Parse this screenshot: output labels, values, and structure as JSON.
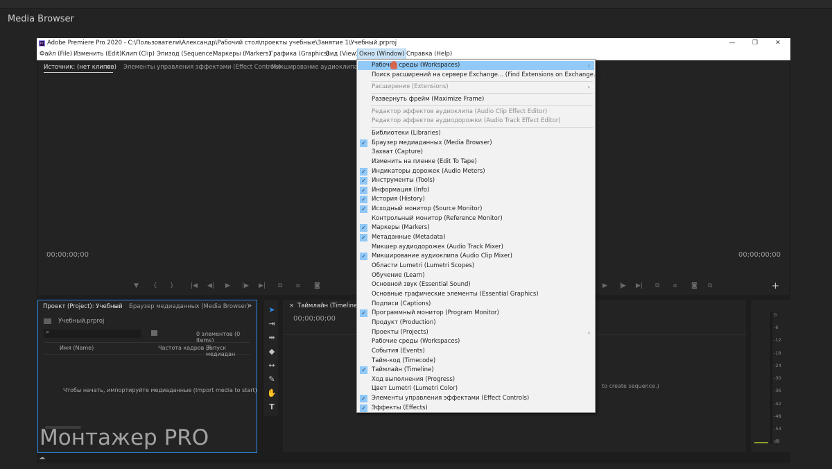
{
  "background": {
    "panel_title": "Media Browser"
  },
  "titlebar": {
    "logo": "Pr",
    "title": "Adobe Premiere Pro 2020 - C:\\Пользователи\\Александр\\Рабочий стол\\проекты учебные\\Занятие 1\\Учебный.prproj",
    "minimize": "—",
    "restore": "❐",
    "close": "✕"
  },
  "menubar": {
    "items": [
      "Файл (File)",
      "Изменить (Edit)",
      "Клип (Clip)",
      "Эпизод (Sequence)",
      "Маркеры (Markers)",
      "Графика (Graphics)",
      "Вид (View)",
      "Окно (Window)",
      "Справка (Help)"
    ]
  },
  "source_panel": {
    "tabs": [
      "Источник: (нет клипов)",
      "Элементы управления эффектами (Effect Controls)",
      "Микширование аудиоклипа (Aud"
    ],
    "timecode_left": "00;00;00;00",
    "timecode_right": "00;00;00;00"
  },
  "project_panel": {
    "tabs": [
      "Проект (Project): Учебный",
      "Браузер медиаданных (Media Browser)"
    ],
    "file_name": "Учебный.prproj",
    "item_count": "0 элементов (0 Items)",
    "columns": [
      "Имя (Name)",
      "Частота кадров (F",
      "Запуск медиадан"
    ],
    "empty_message": "Чтобы начать, импортируйте медиаданные (Import media to start)"
  },
  "timeline_panel": {
    "tab": "Таймлайн (Timeline): (",
    "timecode": "00;00;00;00",
    "hint_fragment": "to create sequence.)"
  },
  "meters": {
    "labels": [
      "0",
      "-6",
      "-12",
      "-18",
      "-24",
      "-30",
      "-36",
      "-42",
      "-48",
      "-54",
      "dB"
    ]
  },
  "window_menu": {
    "items": [
      {
        "label": "Рабочие среды (Workspaces)",
        "checked": false,
        "submenu": true,
        "highlight": true,
        "disabled": false
      },
      {
        "label": "Поиск расширений на сервере Exchange... (Find Extensions on Exchange...)",
        "checked": false,
        "submenu": false,
        "highlight": false,
        "disabled": false
      },
      {
        "label": "Расширения (Extensions)",
        "checked": false,
        "submenu": true,
        "highlight": false,
        "disabled": true
      },
      {
        "label": "Развернуть фрейм (Maximize Frame)",
        "checked": false,
        "submenu": false,
        "highlight": false,
        "disabled": false
      },
      {
        "label": "Редактор эффектов аудиоклипа (Audio Clip Effect Editor)",
        "checked": false,
        "submenu": false,
        "highlight": false,
        "disabled": true
      },
      {
        "label": "Редактор эффектов аудиодорожки (Audio Track Effect Editor)",
        "checked": false,
        "submenu": false,
        "highlight": false,
        "disabled": true
      },
      {
        "label": "Библиотеки (Libraries)",
        "checked": false,
        "submenu": false,
        "highlight": false,
        "disabled": false
      },
      {
        "label": "Браузер медиаданных (Media Browser)",
        "checked": true,
        "submenu": false,
        "highlight": false,
        "disabled": false
      },
      {
        "label": "Захват (Capture)",
        "checked": false,
        "submenu": false,
        "highlight": false,
        "disabled": false
      },
      {
        "label": "Изменить на пленке (Edit To Tape)",
        "checked": false,
        "submenu": false,
        "highlight": false,
        "disabled": false
      },
      {
        "label": "Индикаторы дорожек (Audio Meters)",
        "checked": true,
        "submenu": false,
        "highlight": false,
        "disabled": false
      },
      {
        "label": "Инструменты (Tools)",
        "checked": true,
        "submenu": false,
        "highlight": false,
        "disabled": false
      },
      {
        "label": "Информация (Info)",
        "checked": true,
        "submenu": false,
        "highlight": false,
        "disabled": false
      },
      {
        "label": "История (History)",
        "checked": true,
        "submenu": false,
        "highlight": false,
        "disabled": false
      },
      {
        "label": "Исходный монитор (Source Monitor)",
        "checked": true,
        "submenu": false,
        "highlight": false,
        "disabled": false
      },
      {
        "label": "Контрольный монитор (Reference Monitor)",
        "checked": false,
        "submenu": false,
        "highlight": false,
        "disabled": false
      },
      {
        "label": "Маркеры (Markers)",
        "checked": true,
        "submenu": false,
        "highlight": false,
        "disabled": false
      },
      {
        "label": "Метаданные (Metadata)",
        "checked": true,
        "submenu": false,
        "highlight": false,
        "disabled": false
      },
      {
        "label": "Микшер аудиодорожек (Audio Track Mixer)",
        "checked": false,
        "submenu": false,
        "highlight": false,
        "disabled": false
      },
      {
        "label": "Микширование аудиоклипа (Audio Clip Mixer)",
        "checked": true,
        "submenu": false,
        "highlight": false,
        "disabled": false
      },
      {
        "label": "Области Lumetri (Lumetri Scopes)",
        "checked": false,
        "submenu": false,
        "highlight": false,
        "disabled": false
      },
      {
        "label": "Обучение (Learn)",
        "checked": false,
        "submenu": false,
        "highlight": false,
        "disabled": false
      },
      {
        "label": "Основной звук (Essential Sound)",
        "checked": false,
        "submenu": false,
        "highlight": false,
        "disabled": false
      },
      {
        "label": "Основные графические элементы (Essential Graphics)",
        "checked": false,
        "submenu": false,
        "highlight": false,
        "disabled": false
      },
      {
        "label": "Подписи (Captions)",
        "checked": false,
        "submenu": false,
        "highlight": false,
        "disabled": false
      },
      {
        "label": "Программный монитор (Program Monitor)",
        "checked": true,
        "submenu": false,
        "highlight": false,
        "disabled": false
      },
      {
        "label": "Продукт (Production)",
        "checked": false,
        "submenu": false,
        "highlight": false,
        "disabled": false
      },
      {
        "label": "Проекты (Projects)",
        "checked": false,
        "submenu": true,
        "highlight": false,
        "disabled": false
      },
      {
        "label": "Рабочие среды (Workspaces)",
        "checked": false,
        "submenu": false,
        "highlight": false,
        "disabled": false
      },
      {
        "label": "События (Events)",
        "checked": false,
        "submenu": false,
        "highlight": false,
        "disabled": false
      },
      {
        "label": "Тайм-код (Timecode)",
        "checked": false,
        "submenu": false,
        "highlight": false,
        "disabled": false
      },
      {
        "label": "Таймлайн (Timeline)",
        "checked": true,
        "submenu": false,
        "highlight": false,
        "disabled": false
      },
      {
        "label": "Ход выполнения (Progress)",
        "checked": false,
        "submenu": false,
        "highlight": false,
        "disabled": false
      },
      {
        "label": "Цвет Lumetri (Lumetri Color)",
        "checked": false,
        "submenu": false,
        "highlight": false,
        "disabled": false
      },
      {
        "label": "Элементы управления эффектами (Effect Controls)",
        "checked": true,
        "submenu": false,
        "highlight": false,
        "disabled": false
      },
      {
        "label": "Эффекты (Effects)",
        "checked": true,
        "submenu": false,
        "highlight": false,
        "disabled": false
      }
    ]
  },
  "watermark": "Монтажер PRO",
  "icons": {
    "check": "✓",
    "submenu_arrow": "›",
    "panel_menu": "≡",
    "overflow": "»",
    "search": "⌕",
    "add": "+"
  }
}
